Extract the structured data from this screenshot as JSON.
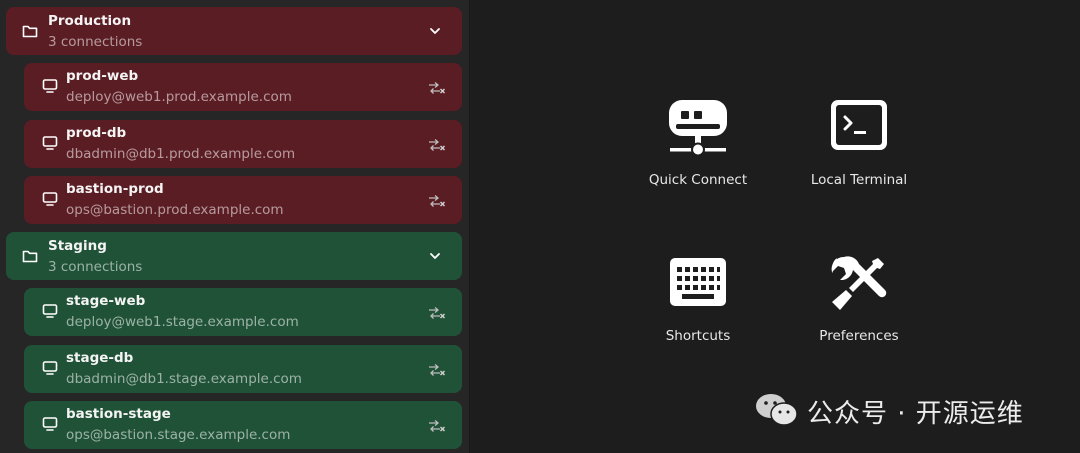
{
  "sidebar": {
    "groups": [
      {
        "name": "Production",
        "count_label": "3 connections",
        "color": "#5b1d24",
        "hosts": [
          {
            "name": "prod-web",
            "address": "deploy@web1.prod.example.com"
          },
          {
            "name": "prod-db",
            "address": "dbadmin@db1.prod.example.com"
          },
          {
            "name": "bastion-prod",
            "address": "ops@bastion.prod.example.com"
          }
        ]
      },
      {
        "name": "Staging",
        "count_label": "3 connections",
        "color": "#205237",
        "hosts": [
          {
            "name": "stage-web",
            "address": "deploy@web1.stage.example.com"
          },
          {
            "name": "stage-db",
            "address": "dbadmin@db1.stage.example.com"
          },
          {
            "name": "bastion-stage",
            "address": "ops@bastion.stage.example.com"
          }
        ]
      }
    ],
    "icons": {
      "group": "folder-icon",
      "host": "monitor-icon",
      "expand": "chevron-down-icon",
      "action": "disconnect-icon"
    }
  },
  "main": {
    "tiles": [
      {
        "label": "Quick Connect",
        "icon": "network-server-icon"
      },
      {
        "label": "Local Terminal",
        "icon": "terminal-icon"
      },
      {
        "label": "Shortcuts",
        "icon": "keyboard-icon"
      },
      {
        "label": "Preferences",
        "icon": "tools-icon"
      }
    ]
  },
  "watermark": {
    "text": "公众号 · 开源运维",
    "icon": "wechat-icon"
  }
}
